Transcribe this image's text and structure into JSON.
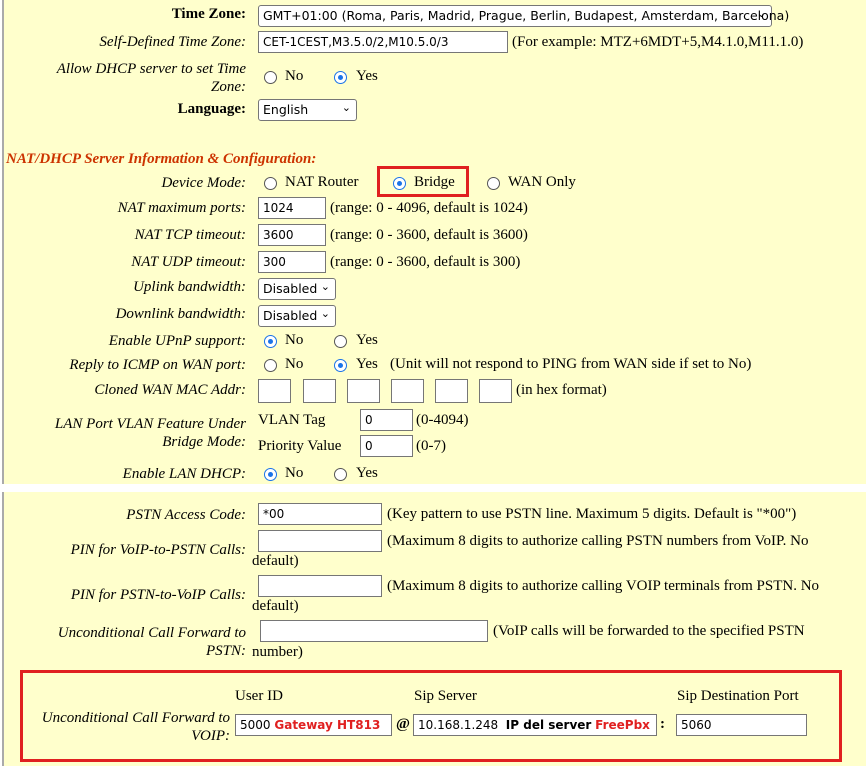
{
  "time_zone": {
    "label": "Time Zone:",
    "value": "GMT+01:00 (Roma, Paris, Madrid, Prague, Berlin, Budapest, Amsterdam, Barcelona)"
  },
  "self_defined_tz": {
    "label": "Self-Defined Time Zone:",
    "value": "CET-1CEST,M3.5.0/2,M10.5.0/3",
    "hint": "(For example: MTZ+6MDT+5,M4.1.0,M11.1.0)"
  },
  "dhcp_time_zone": {
    "label_line1": "Allow DHCP server to set Time",
    "label_line2": "Zone:",
    "no": "No",
    "yes": "Yes",
    "selected": "Yes"
  },
  "language": {
    "label": "Language:",
    "value": "English"
  },
  "nat_section": {
    "title": "NAT/DHCP Server Information & Configuration:",
    "device_mode": {
      "label": "Device Mode:",
      "options": [
        "NAT Router",
        "Bridge",
        "WAN Only"
      ],
      "selected": "Bridge"
    },
    "nat_max_ports": {
      "label": "NAT maximum ports:",
      "value": "1024",
      "hint": "(range: 0 - 4096, default is 1024)"
    },
    "nat_tcp": {
      "label": "NAT TCP timeout:",
      "value": "3600",
      "hint": "(range: 0 - 3600, default is 3600)"
    },
    "nat_udp": {
      "label": "NAT UDP timeout:",
      "value": "300",
      "hint": "(range: 0 - 3600, default is 300)"
    },
    "uplink": {
      "label": "Uplink bandwidth:",
      "value": "Disabled"
    },
    "downlink": {
      "label": "Downlink bandwidth:",
      "value": "Disabled"
    },
    "upnp": {
      "label": "Enable UPnP support:",
      "no": "No",
      "yes": "Yes",
      "selected": "No"
    },
    "icmp": {
      "label": "Reply to ICMP on WAN port:",
      "no": "No",
      "yes": "Yes",
      "selected": "Yes",
      "hint": "(Unit will not respond to PING from WAN side if set to No)"
    },
    "cloned_mac": {
      "label": "Cloned WAN MAC Addr:",
      "hint": "(in hex format)"
    },
    "lan_vlan": {
      "label_line1": "LAN Port VLAN Feature Under",
      "label_line2": "Bridge Mode:",
      "vlan_tag_label": "VLAN Tag",
      "vlan_tag_value": "0",
      "vlan_tag_hint": "(0-4094)",
      "priority_label": "Priority Value",
      "priority_value": "0",
      "priority_hint": "(0-7)"
    },
    "lan_dhcp": {
      "label": "Enable LAN DHCP:",
      "no": "No",
      "yes": "Yes",
      "selected": "No"
    }
  },
  "pstn": {
    "access_code": {
      "label": "PSTN Access Code:",
      "value": "*00",
      "hint": "(Key pattern to use PSTN line. Maximum 5 digits. Default is \"*00\")"
    },
    "pin_voip_pstn": {
      "label": "PIN for VoIP-to-PSTN Calls:",
      "hint_line1": "(Maximum 8 digits to authorize calling PSTN numbers from VoIP.  No",
      "hint_line2": "default)"
    },
    "pin_pstn_voip": {
      "label": "PIN for PSTN-to-VoIP Calls:",
      "hint_line1": "(Maximum 8 digits to authorize calling VOIP terminals from PSTN.  No",
      "hint_line2": "default)"
    },
    "ucf_pstn": {
      "label_line1": "Unconditional Call Forward to",
      "label_line2": "PSTN:",
      "hint_line1": "(VoIP calls will be forwarded to the specified PSTN",
      "hint_line2": "number)"
    }
  },
  "ucf_voip": {
    "label_line1": "Unconditional Call Forward to",
    "label_line2": "VOIP:",
    "user_id_header": "User ID",
    "sip_server_header": "Sip Server",
    "sip_port_header": "Sip Destination Port",
    "user_id_value": "5000",
    "user_id_note": "Gateway HT813",
    "at": "@",
    "sip_server_value": "10.168.1.248",
    "sip_server_note_prefix": "IP del server",
    "sip_server_note_brand": "FreePbx",
    "colon": ":",
    "sip_port_value": "5060"
  },
  "colors": {
    "panel_bg": "#ffffcc",
    "section_title": "#cc3300",
    "highlight": "#e02020",
    "radio_accent": "#1a73e8"
  }
}
